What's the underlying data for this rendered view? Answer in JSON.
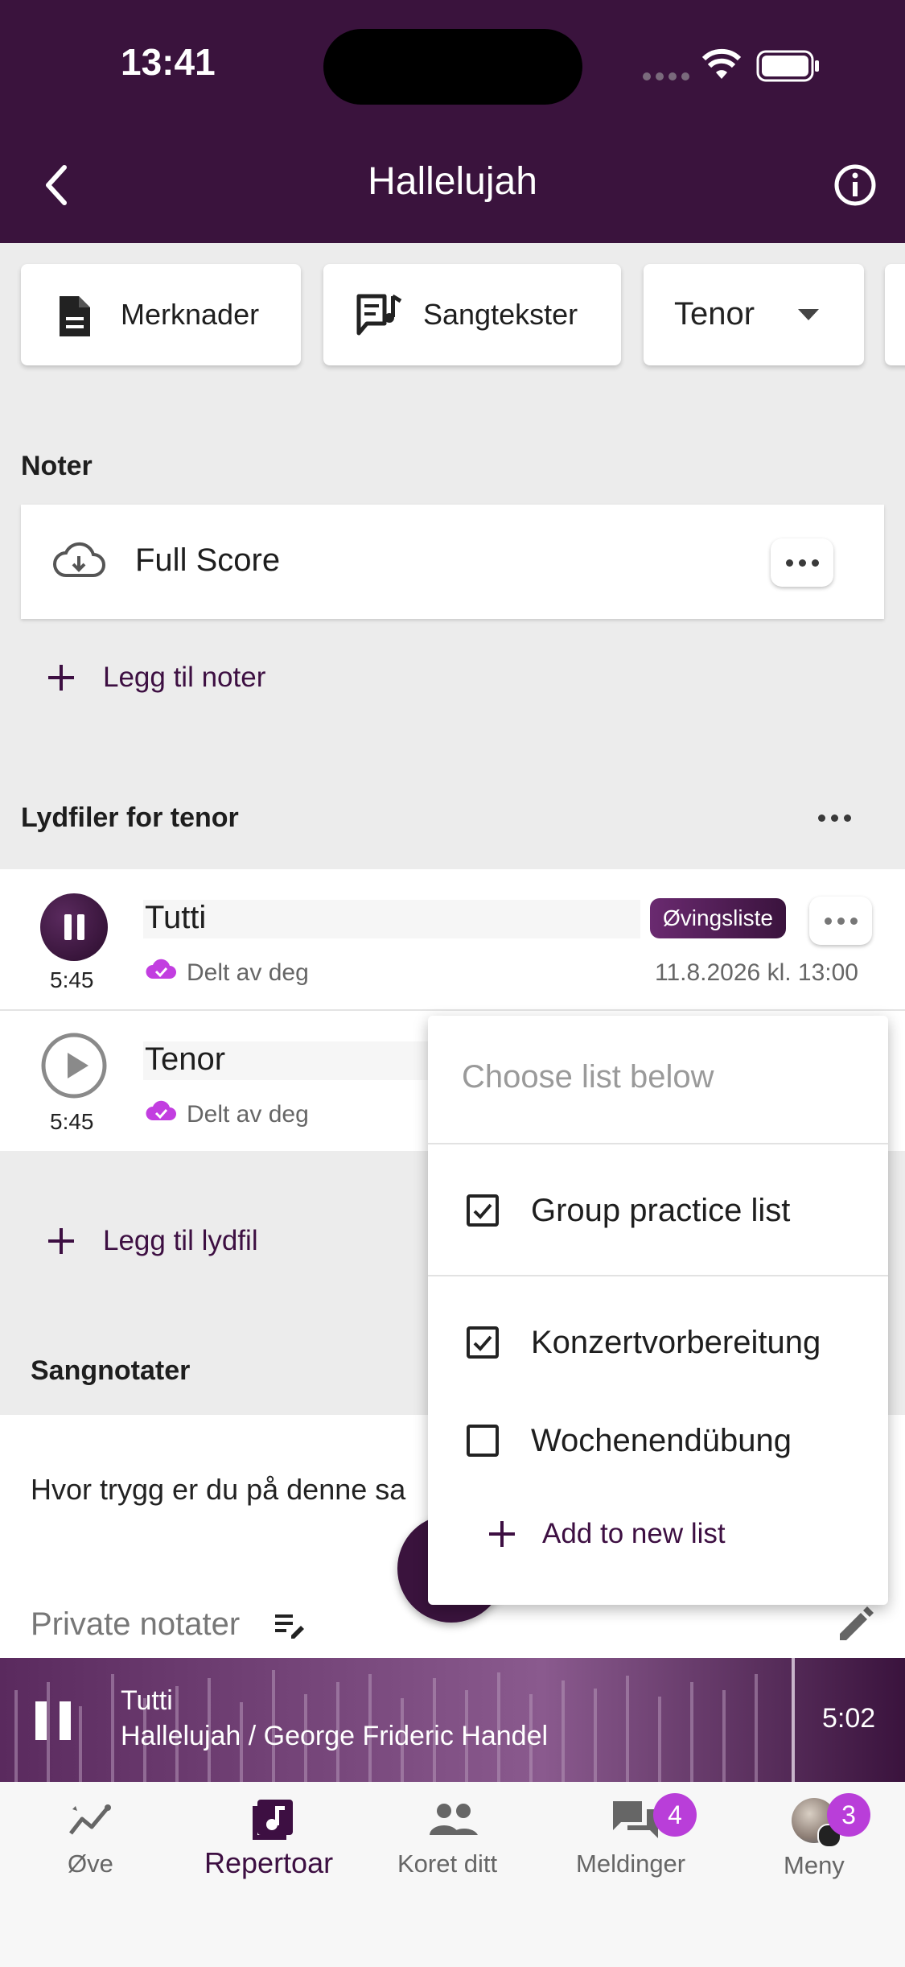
{
  "status_bar": {
    "time": "13:41"
  },
  "header": {
    "title": "Hallelujah"
  },
  "chips": [
    {
      "label": "Merknader",
      "icon": "document-icon"
    },
    {
      "label": "Sangtekster",
      "icon": "lyrics-icon"
    },
    {
      "label": "Tenor",
      "icon": "dropdown-arrow-icon"
    }
  ],
  "scores": {
    "heading": "Noter",
    "items": [
      {
        "label": "Full Score",
        "icon": "cloud-download-icon"
      }
    ],
    "add_label": "Legg til noter"
  },
  "audio": {
    "heading": "Lydfiler for tenor",
    "tracks": [
      {
        "title": "Tutti",
        "duration": "5:45",
        "shared": "Delt av deg",
        "tag": "Øvingsliste",
        "date": "11.8.2026 kl. 13:00",
        "state": "playing"
      },
      {
        "title": "Tenor",
        "duration": "5:45",
        "shared": "Delt av deg",
        "state": "paused"
      }
    ],
    "add_label": "Legg til lydfil"
  },
  "notes": {
    "heading": "Sangnotater",
    "question": "Hvor trygg er du på denne sa",
    "private_label": "Private notater"
  },
  "dropdown": {
    "header": "Choose list below",
    "items": [
      {
        "label": "Group practice list",
        "checked": true
      },
      {
        "label": "Konzertvorbereitung",
        "checked": true
      },
      {
        "label": "Wochenendübung",
        "checked": false
      }
    ],
    "add_label": "Add to new list"
  },
  "player": {
    "title": "Tutti",
    "subtitle": "Hallelujah / George Frideric Handel",
    "time": "5:02"
  },
  "bottom_nav": [
    {
      "label": "Øve",
      "icon": "trend-icon"
    },
    {
      "label": "Repertoar",
      "icon": "music-note-icon",
      "active": true
    },
    {
      "label": "Koret ditt",
      "icon": "people-icon"
    },
    {
      "label": "Meldinger",
      "icon": "chat-icon",
      "badge": "4"
    },
    {
      "label": "Meny",
      "icon": "avatar-icon",
      "badge": "3"
    }
  ],
  "colors": {
    "brand": "#3a133d",
    "accent": "#b93ed9",
    "background": "#ececec"
  }
}
